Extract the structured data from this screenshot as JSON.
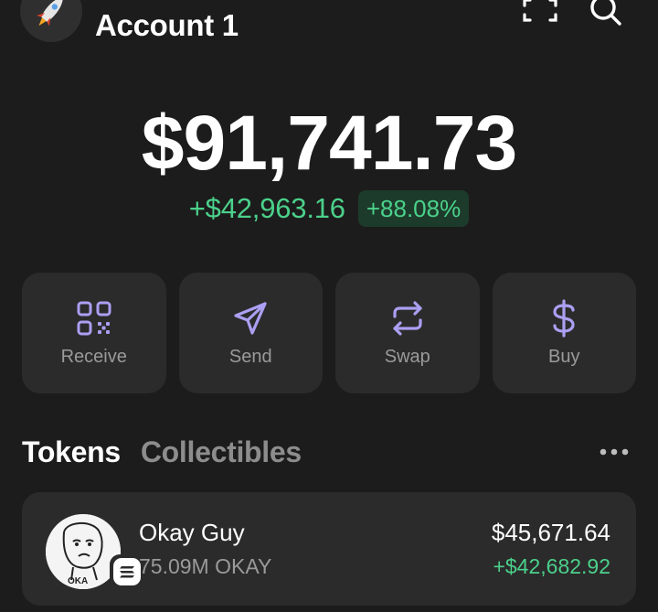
{
  "header": {
    "account_name": "Account 1",
    "avatar_icon": "rocket-icon",
    "scan_icon": "scan-qr-icon",
    "search_icon": "search-icon"
  },
  "balance": {
    "total": "$91,741.73",
    "change_amount": "+$42,963.16",
    "change_percent": "+88.08%"
  },
  "actions": [
    {
      "label": "Receive",
      "icon": "qr-code-icon"
    },
    {
      "label": "Send",
      "icon": "send-icon"
    },
    {
      "label": "Swap",
      "icon": "swap-icon"
    },
    {
      "label": "Buy",
      "icon": "dollar-icon"
    }
  ],
  "tabs": [
    {
      "label": "Tokens",
      "active": true
    },
    {
      "label": "Collectibles",
      "active": false
    }
  ],
  "more_icon": "more-horizontal-icon",
  "tokens": [
    {
      "name": "Okay Guy",
      "amount": "75.09M OKAY",
      "value": "$45,671.64",
      "change": "+$42,682.92",
      "logo_text": "OKAY",
      "chain_icon": "solana-icon"
    }
  ],
  "colors": {
    "background": "#1c1c1c",
    "card": "#2b2b2b",
    "accent": "#ab9ff2",
    "positive": "#4bd18b",
    "positive_bg": "#1d3b2b",
    "muted_text": "#9a9a9a"
  }
}
